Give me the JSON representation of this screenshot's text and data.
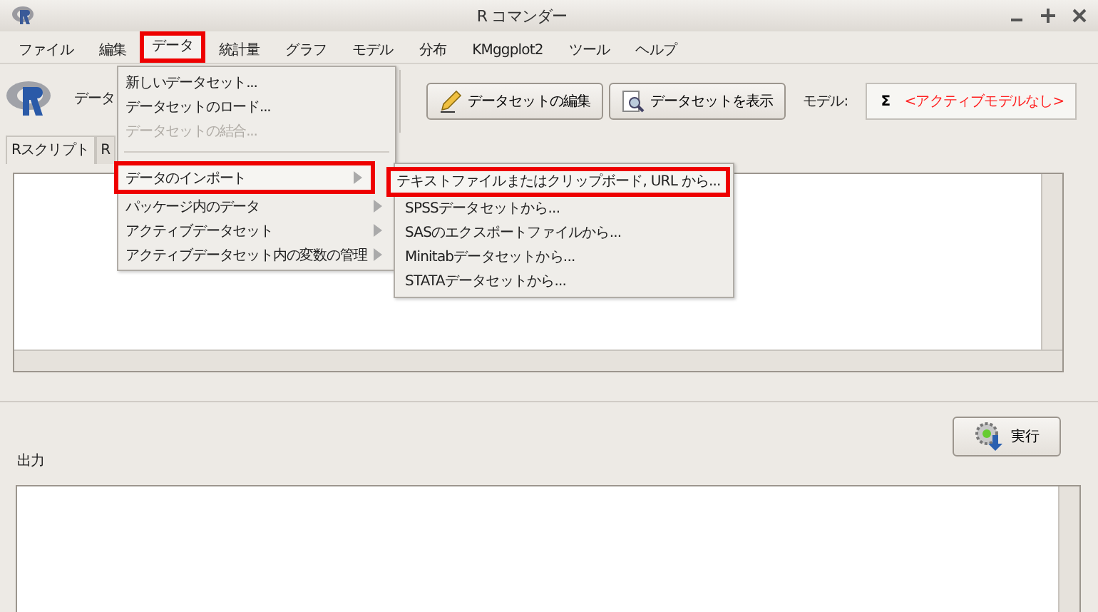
{
  "window": {
    "title": "R コマンダー"
  },
  "menubar": [
    {
      "label": "ファイル",
      "selected": false
    },
    {
      "label": "編集",
      "selected": false
    },
    {
      "label": "データ",
      "selected": true
    },
    {
      "label": "統計量",
      "selected": false
    },
    {
      "label": "グラフ",
      "selected": false
    },
    {
      "label": "モデル",
      "selected": false
    },
    {
      "label": "分布",
      "selected": false
    },
    {
      "label": "KMggplot2",
      "selected": false
    },
    {
      "label": "ツール",
      "selected": false
    },
    {
      "label": "ヘルプ",
      "selected": false
    }
  ],
  "toolbar": {
    "dataset_label": "データ",
    "buttons": [
      {
        "label": "データセットの編集",
        "kind": "edit"
      },
      {
        "label": "データセットを表示",
        "kind": "view"
      }
    ],
    "model_label": "モデル:",
    "model_icon": "Σ",
    "model_value": "<アクティブモデルなし>"
  },
  "tabs": [
    {
      "label": "Rスクリプト",
      "selected": true
    },
    {
      "label": "R",
      "selected": false
    }
  ],
  "output_label": "出力",
  "run_button": "実行",
  "menu": {
    "items": [
      {
        "kind": "item",
        "label": "新しいデータセット...",
        "disabled": false,
        "submenu": false,
        "selected": false
      },
      {
        "kind": "item",
        "label": "データセットのロード...",
        "disabled": false,
        "submenu": false,
        "selected": false
      },
      {
        "kind": "item",
        "label": "データセットの結合...",
        "disabled": true,
        "submenu": false,
        "selected": false
      },
      {
        "kind": "separator"
      },
      {
        "kind": "item",
        "label": "データのインポート",
        "disabled": false,
        "submenu": true,
        "selected": true
      },
      {
        "kind": "item",
        "label": "パッケージ内のデータ",
        "disabled": false,
        "submenu": true,
        "selected": false
      },
      {
        "kind": "item",
        "label": "アクティブデータセット",
        "disabled": false,
        "submenu": true,
        "selected": false
      },
      {
        "kind": "item",
        "label": "アクティブデータセット内の変数の管理",
        "disabled": false,
        "submenu": true,
        "selected": false
      }
    ]
  },
  "submenu": {
    "items": [
      {
        "label": "テキストファイルまたはクリップボード, URL から...",
        "selected": true
      },
      {
        "label": "SPSSデータセットから...",
        "selected": false
      },
      {
        "label": "SASのエクスポートファイルから...",
        "selected": false
      },
      {
        "label": "Minitabデータセットから...",
        "selected": false
      },
      {
        "label": "STATAデータセットから...",
        "selected": false
      }
    ]
  }
}
